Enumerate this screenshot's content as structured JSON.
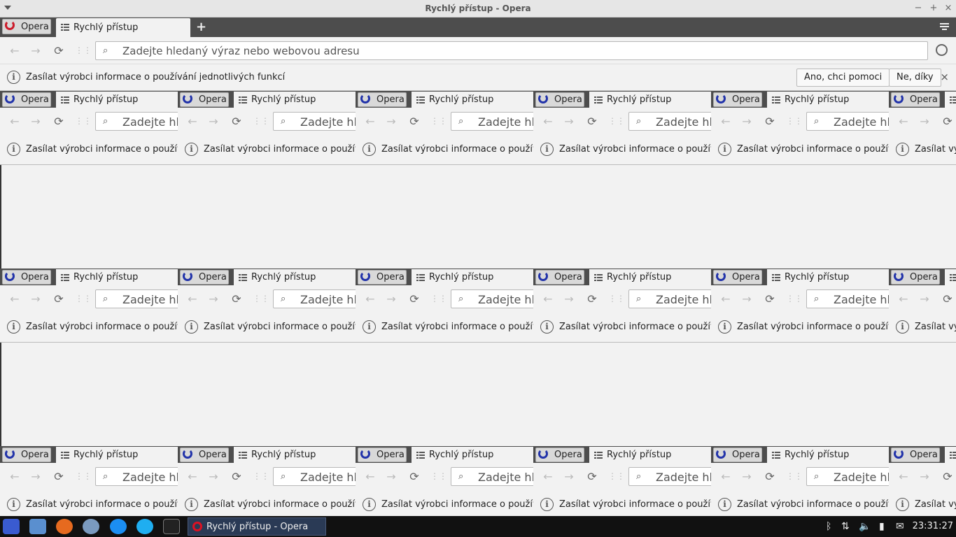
{
  "window": {
    "title": "Rychlý přístup - Opera",
    "controls": [
      "−",
      "+",
      "×"
    ]
  },
  "tabs": {
    "opera_menu_label": "Opera",
    "active_tab_label": "Rychlý přístup",
    "new_tab": "+"
  },
  "nav": {
    "back": "←",
    "forward": "→",
    "reload": "⟳",
    "grid": "⋮⋮",
    "search_placeholder": "Zadejte hledaný výraz nebo webovou adresu",
    "search_placeholder_short": "Zadejte hle",
    "search_glyph": "⌕"
  },
  "infobar": {
    "icon": "i",
    "text": "Zasílat výrobci informace o používání jednotlivých funkcí",
    "text_short": "Zasílat výrobci informace o používání",
    "accept_button": "Ano, chci pomoci",
    "decline_button": "Ne, díky",
    "close": "×"
  },
  "taskbar": {
    "task_label": "Rychlý přístup - Opera",
    "clock": "23:31:27",
    "apps": [
      "menu-icon",
      "files-icon",
      "firefox-icon",
      "thunderbird-icon",
      "messenger-icon",
      "skype-icon",
      "terminal-icon"
    ],
    "tray": [
      "bluetooth-icon",
      "network-icon",
      "volume-icon",
      "battery-icon",
      "mail-icon"
    ]
  },
  "colors": {
    "tabbar": "#4d4d4d",
    "chrome": "#f2f2f2",
    "taskbar": "#111111",
    "opera_red": "#cc1b2b"
  }
}
